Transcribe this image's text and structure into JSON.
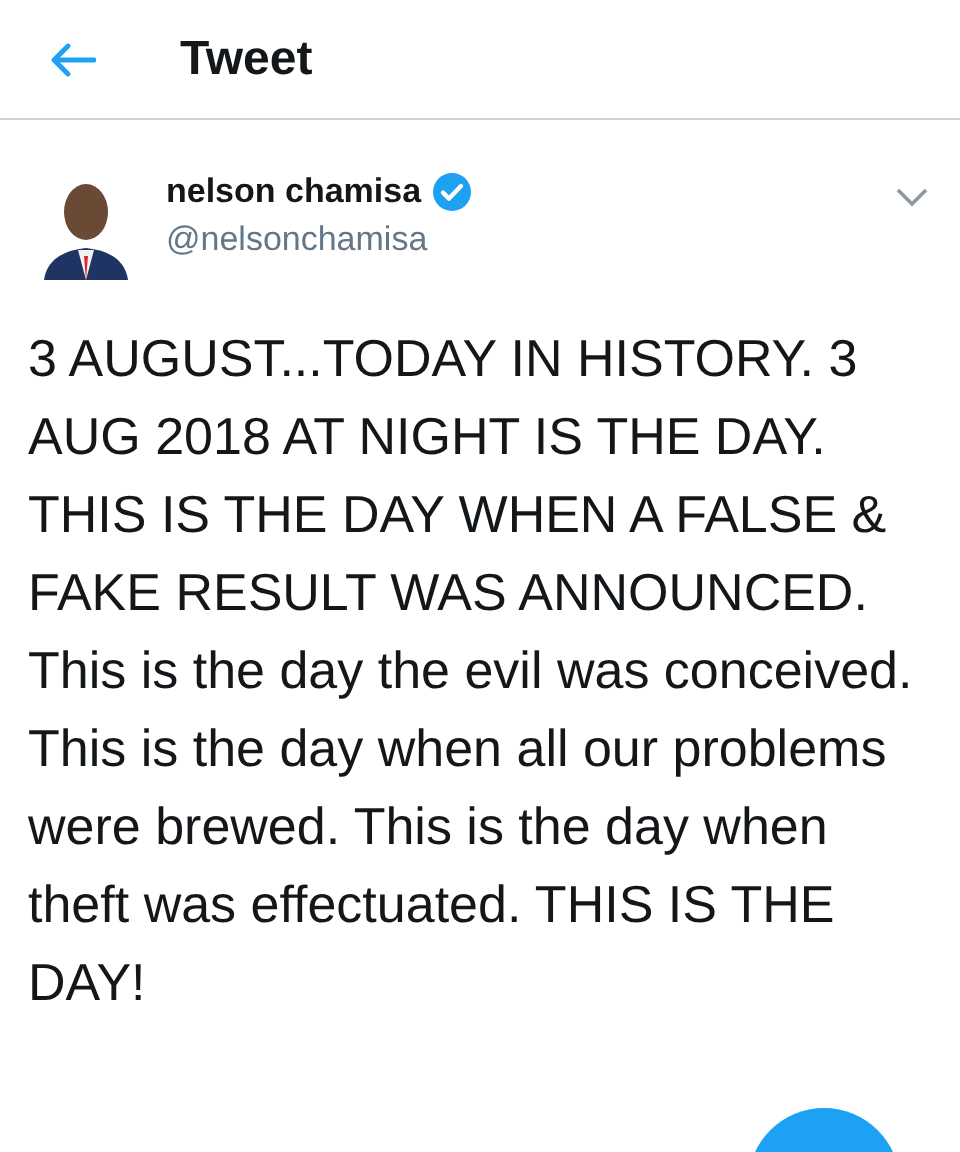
{
  "header": {
    "title": "Tweet"
  },
  "tweet": {
    "author": {
      "name": "nelson chamisa",
      "verified": true,
      "handle": "@nelsonchamisa"
    },
    "text": "3 AUGUST...TODAY IN HISTORY. 3 AUG 2018 AT NIGHT IS THE DAY. THIS IS THE DAY WHEN A FALSE & FAKE RESULT WAS ANNOUNCED. This is the day the evil was conceived. This is the day when all our problems were brewed. This is the day when theft was effectuated. THIS IS THE DAY!"
  }
}
